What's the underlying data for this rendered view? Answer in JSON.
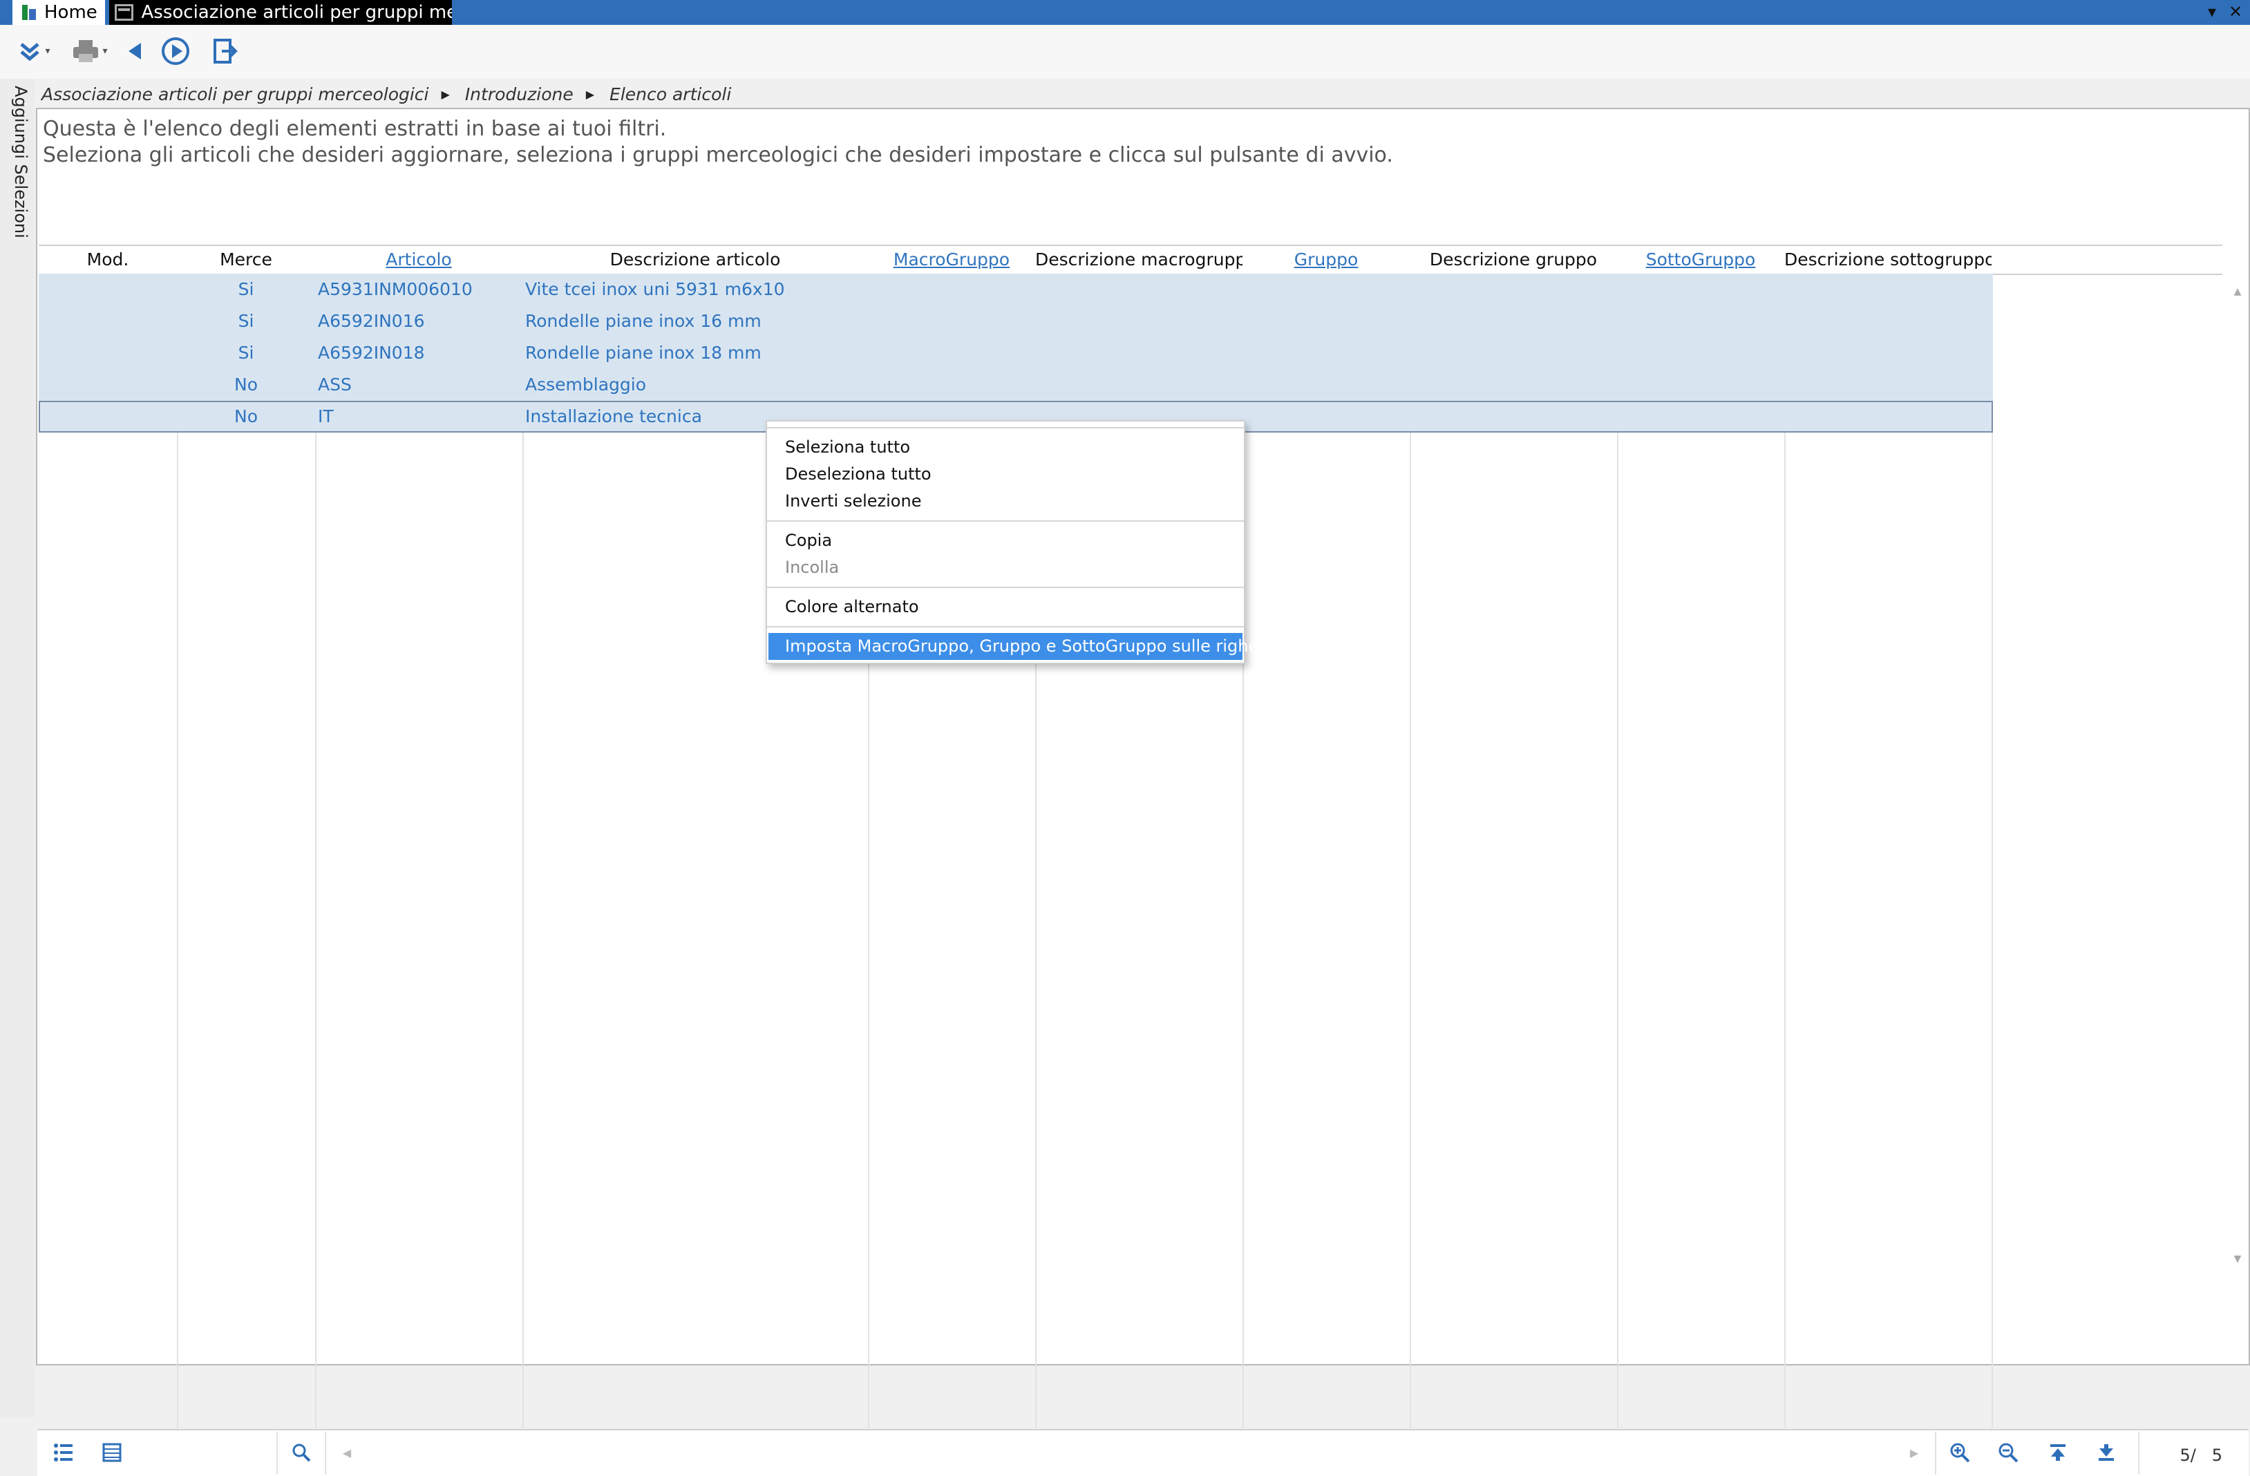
{
  "titlebar": {
    "home_tab": "Home",
    "doc_tab": "Associazione articoli per gruppi me...",
    "minimize": "▾",
    "close": "✕"
  },
  "side_rail": {
    "label": "Aggiungi Selezioni"
  },
  "breadcrumb": {
    "items": [
      "Associazione articoli per gruppi merceologici",
      "Introduzione",
      "Elenco articoli"
    ]
  },
  "intro": {
    "line1": "Questa è l'elenco degli elementi estratti in base ai tuoi filtri.",
    "line2": "Seleziona gli articoli che desideri aggiornare, seleziona i gruppi merceologici che desideri impostare e clicca sul pulsante di avvio."
  },
  "table": {
    "columns": [
      {
        "label": "Mod.",
        "link": false
      },
      {
        "label": "Merce",
        "link": false
      },
      {
        "label": "Articolo",
        "link": true
      },
      {
        "label": "Descrizione articolo",
        "link": false
      },
      {
        "label": "MacroGruppo",
        "link": true
      },
      {
        "label": "Descrizione macrogruppo",
        "link": false
      },
      {
        "label": "Gruppo",
        "link": true
      },
      {
        "label": "Descrizione gruppo",
        "link": false
      },
      {
        "label": "SottoGruppo",
        "link": true
      },
      {
        "label": "Descrizione sottogruppo",
        "link": false
      }
    ],
    "rows": [
      {
        "merce": "Si",
        "articolo": "A5931INM006010",
        "descrizione": "Vite tcei inox uni 5931 m6x10"
      },
      {
        "merce": "Si",
        "articolo": "A6592IN016",
        "descrizione": "Rondelle piane inox 16 mm"
      },
      {
        "merce": "Si",
        "articolo": "A6592IN018",
        "descrizione": "Rondelle piane inox 18 mm"
      },
      {
        "merce": "No",
        "articolo": "ASS",
        "descrizione": "Assemblaggio"
      },
      {
        "merce": "No",
        "articolo": "IT",
        "descrizione": "Installazione tecnica"
      }
    ]
  },
  "context_menu": {
    "select_all": "Seleziona tutto",
    "deselect_all": "Deseleziona tutto",
    "invert_selection": "Inverti selezione",
    "copy": "Copia",
    "paste": "Incolla",
    "alternate_color": "Colore alternato",
    "set_groups": "Imposta MacroGruppo, Gruppo e SottoGruppo sulle righe..."
  },
  "pager": {
    "current": "5/",
    "total": "5"
  },
  "colors": {
    "titlebar": "#2f6fb9",
    "row_selected": "#d8e5f1",
    "link": "#2f74bf",
    "menu_highlight": "#3d8ee8"
  }
}
